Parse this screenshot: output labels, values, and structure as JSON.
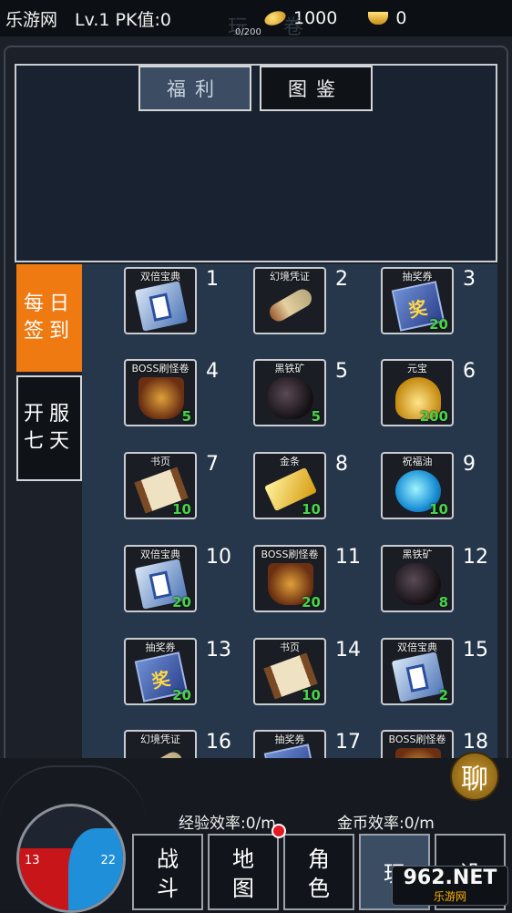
{
  "topbar": {
    "site": "乐游网",
    "level": "Lv.1 PK值:0",
    "gold": "1000",
    "ingot": "0",
    "progress": "0/200",
    "title_ghost": "玩 卷"
  },
  "tabs": {
    "welfare": "福利",
    "catalog": "图鉴"
  },
  "side_tabs": {
    "daily_line1": "每日",
    "daily_line2": "签到",
    "seven_line1": "开服",
    "seven_line2": "七天"
  },
  "rewards": [
    {
      "day": "1",
      "name": "双倍宝典",
      "qty": "",
      "icon": "book"
    },
    {
      "day": "2",
      "name": "幻境凭证",
      "qty": "",
      "icon": "scroll"
    },
    {
      "day": "3",
      "name": "抽奖券",
      "qty": "20",
      "icon": "ticket"
    },
    {
      "day": "4",
      "name": "BOSS刷怪卷",
      "qty": "5",
      "icon": "boss"
    },
    {
      "day": "5",
      "name": "黑铁矿",
      "qty": "5",
      "icon": "ore"
    },
    {
      "day": "6",
      "name": "元宝",
      "qty": "200",
      "icon": "yuanbao"
    },
    {
      "day": "7",
      "name": "书页",
      "qty": "10",
      "icon": "page"
    },
    {
      "day": "8",
      "name": "金条",
      "qty": "10",
      "icon": "gold"
    },
    {
      "day": "9",
      "name": "祝福油",
      "qty": "10",
      "icon": "oil"
    },
    {
      "day": "10",
      "name": "双倍宝典",
      "qty": "20",
      "icon": "book"
    },
    {
      "day": "11",
      "name": "BOSS刷怪卷",
      "qty": "20",
      "icon": "boss"
    },
    {
      "day": "12",
      "name": "黑铁矿",
      "qty": "8",
      "icon": "ore"
    },
    {
      "day": "13",
      "name": "抽奖券",
      "qty": "20",
      "icon": "ticket"
    },
    {
      "day": "14",
      "name": "书页",
      "qty": "10",
      "icon": "page"
    },
    {
      "day": "15",
      "name": "双倍宝典",
      "qty": "2",
      "icon": "book"
    },
    {
      "day": "16",
      "name": "幻境凭证",
      "qty": "",
      "icon": "scroll"
    },
    {
      "day": "17",
      "name": "抽奖券",
      "qty": "",
      "icon": "ticket"
    },
    {
      "day": "18",
      "name": "BOSS刷怪卷",
      "qty": "",
      "icon": "boss"
    }
  ],
  "chat": "聊",
  "efficiency": {
    "exp": "经验效率:0/m",
    "gold": "金币效率:0/m"
  },
  "orb": {
    "hp": "13",
    "mp": "22"
  },
  "nav": [
    {
      "line1": "战",
      "line2": "斗"
    },
    {
      "line1": "地",
      "line2": "图"
    },
    {
      "line1": "角",
      "line2": "色"
    },
    {
      "line1": "玩",
      "line2": ""
    },
    {
      "line1": "设",
      "line2": ""
    }
  ],
  "logo": {
    "main": "962.NET",
    "sub": "乐游网"
  }
}
